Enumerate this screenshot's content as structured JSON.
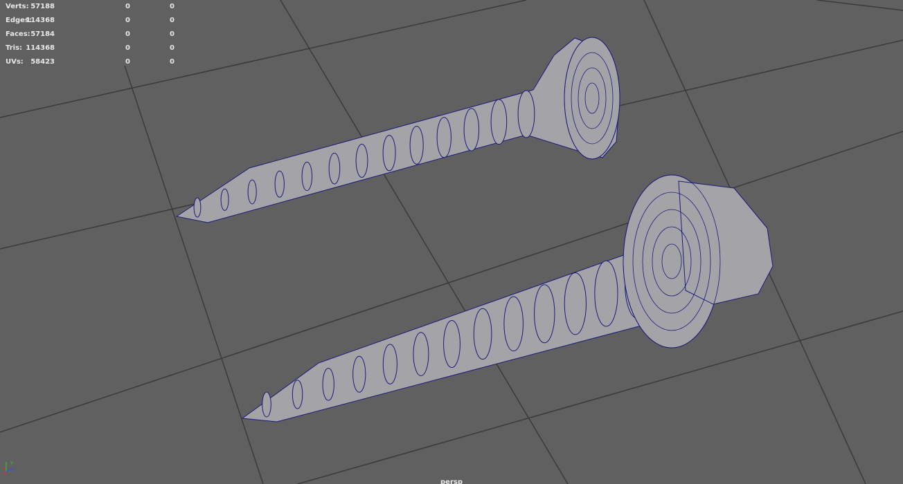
{
  "hud": {
    "rows": [
      {
        "label": "Verts:",
        "total": "57188",
        "selected": "0",
        "extra": "0"
      },
      {
        "label": "Edges:",
        "total": "114368",
        "selected": "0",
        "extra": "0"
      },
      {
        "label": "Faces:",
        "total": "57184",
        "selected": "0",
        "extra": "0"
      },
      {
        "label": "Tris:",
        "total": "114368",
        "selected": "0",
        "extra": "0"
      },
      {
        "label": "UVs:",
        "total": "58423",
        "selected": "0",
        "extra": "0"
      }
    ]
  },
  "camera": {
    "name": "persp"
  },
  "axis_gizmo": {
    "x": "x",
    "y": "y",
    "z": "z"
  },
  "colors": {
    "background": "#606060",
    "grid_line": "#3a3a3a",
    "mesh_fill": "#a4a4a8",
    "wireframe": "#1a1a7a",
    "axis_x": "#e03030",
    "axis_y": "#30c030",
    "axis_z": "#3050ff"
  },
  "objects": [
    {
      "name": "countersunk-screw"
    },
    {
      "name": "hex-flange-screw"
    }
  ]
}
